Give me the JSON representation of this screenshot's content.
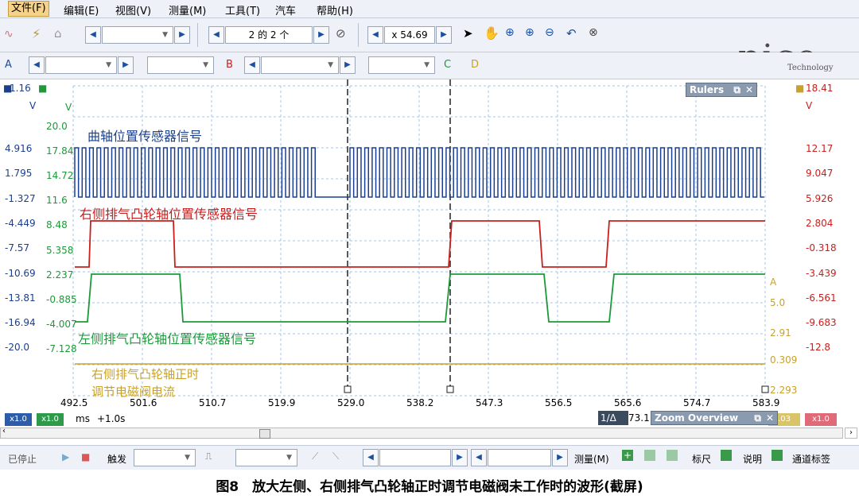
{
  "menu": [
    "文件(F)",
    "编辑(E)",
    "视图(V)",
    "测量(M)",
    "工具(T)",
    "汽车",
    "帮助(H)"
  ],
  "toolbar": {
    "capture_count": "2 的 2 个",
    "zoom": "x 54.69",
    "channel_a": "A",
    "channel_b": "B",
    "channel_c": "C",
    "channel_d": "D"
  },
  "brand": {
    "logo": "pico",
    "tagline": "Technology"
  },
  "rulers_panel": {
    "title": "Rulers"
  },
  "zoom_panel": {
    "title": "Zoom Overview",
    "ruler_readout": "1/Δ",
    "ruler_value": "73.1"
  },
  "left_axes": {
    "top_value": "1.16",
    "unit1": "V",
    "unit2": "V",
    "col1": [
      "4.916",
      "1.795",
      "-1.327",
      "-4.449",
      "-7.57",
      "-10.69",
      "-13.81",
      "-16.94",
      "-20.0"
    ],
    "col2": [
      "20.0",
      "17.84",
      "14.72",
      "11.6",
      "8.48",
      "5.358",
      "2.237",
      "-0.885",
      "-4.007",
      "-7.128"
    ]
  },
  "right_axes": {
    "top_value": "18.41",
    "unit_v": "V",
    "col_v": [
      "12.17",
      "9.047",
      "5.926",
      "2.804",
      "-0.318",
      "-3.439",
      "-6.561",
      "-9.683",
      "-12.8"
    ],
    "unit_a": "A",
    "col_a": [
      "5.0",
      "2.91",
      "0.309",
      "2.293"
    ]
  },
  "time_axis": {
    "ticks": [
      "492.5",
      "501.6",
      "510.7",
      "519.9",
      "529.0",
      "538.2",
      "547.3",
      "556.5",
      "565.6",
      "574.7",
      "583.9"
    ],
    "unit": "ms",
    "offset": "+1.0s",
    "scale_a": "x1.0",
    "scale_b": "x1.0",
    "scale_c": "x1.0",
    "scale_d": ".03"
  },
  "traces": {
    "crank": {
      "label": "曲轴位置传感器信号",
      "color": "#1a3f8f"
    },
    "right_cam": {
      "label": "右侧排气凸轮轴位置传感器信号",
      "color": "#c8201e"
    },
    "left_cam": {
      "label": "左侧排气凸轮轴位置传感器信号",
      "color": "#1c9a3a"
    },
    "solenoid": {
      "label": "右侧排气凸轮轴正时\n调节电磁阀电流",
      "label_line1": "右侧排气凸轮轴正时",
      "label_line2": "调节电磁阀电流",
      "color": "#c9a227"
    }
  },
  "statusbar": {
    "stopped": "已停止",
    "trigger": "触发",
    "measure": "测量(M)",
    "ruler": "标尺",
    "notes": "说明",
    "channel_labels": "通道标签"
  },
  "caption": "图8　放大左侧、右侧排气凸轮轴正时调节电磁阀未工作时的波形(截屏)"
}
